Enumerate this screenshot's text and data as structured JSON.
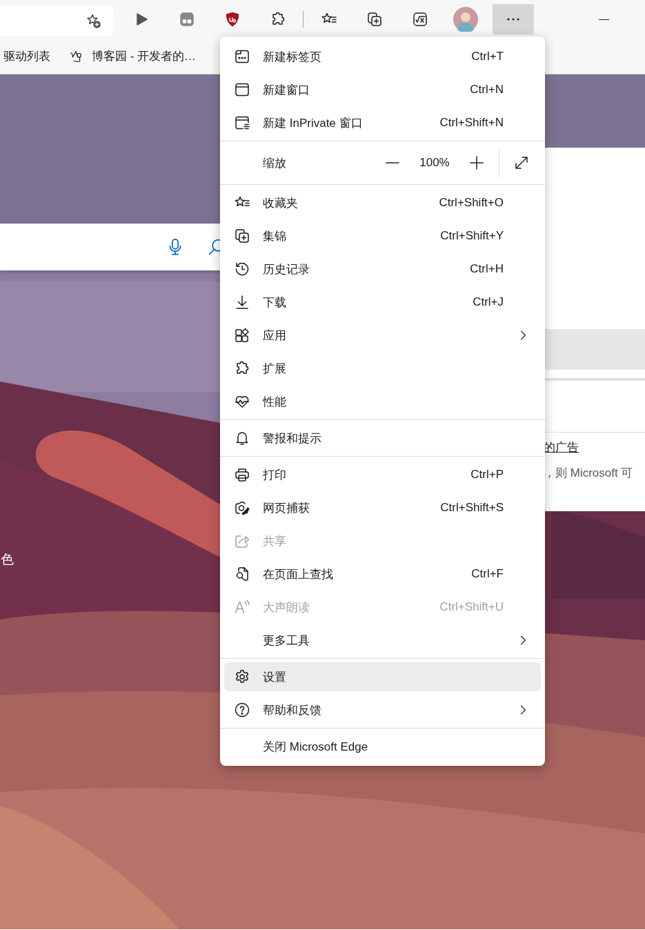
{
  "toolbar": {
    "buttons": [
      {
        "selected": false
      },
      {
        "selected": false
      },
      {
        "selected": false
      },
      {
        "selected": false
      },
      {
        "selected": false
      },
      {
        "selected": false
      },
      {
        "selected": false
      },
      {
        "selected": false
      },
      {
        "selected": true
      }
    ]
  },
  "bookmarks": [
    {
      "label": "驱动列表"
    },
    {
      "label": "博客园 - 开发者的…"
    }
  ],
  "background_caption": "色",
  "side_panel": {
    "link": "的广告",
    "text": "，则 Microsoft 可"
  },
  "menu": {
    "sections": [
      [
        {
          "kind": "command",
          "label": "新建标签页",
          "shortcut": "Ctrl+T",
          "disabled": false,
          "submenu": false,
          "selected": false
        },
        {
          "kind": "command",
          "label": "新建窗口",
          "shortcut": "Ctrl+N",
          "disabled": false,
          "submenu": false,
          "selected": false
        },
        {
          "kind": "command",
          "label": "新建 InPrivate 窗口",
          "shortcut": "Ctrl+Shift+N",
          "disabled": false,
          "submenu": false,
          "selected": false
        }
      ],
      [
        {
          "kind": "zoom",
          "label": "缩放",
          "value": "100%"
        }
      ],
      [
        {
          "kind": "command",
          "label": "收藏夹",
          "shortcut": "Ctrl+Shift+O",
          "disabled": false,
          "submenu": false,
          "selected": false
        },
        {
          "kind": "command",
          "label": "集锦",
          "shortcut": "Ctrl+Shift+Y",
          "disabled": false,
          "submenu": false,
          "selected": false
        },
        {
          "kind": "command",
          "label": "历史记录",
          "shortcut": "Ctrl+H",
          "disabled": false,
          "submenu": false,
          "selected": false
        },
        {
          "kind": "command",
          "label": "下载",
          "shortcut": "Ctrl+J",
          "disabled": false,
          "submenu": false,
          "selected": false
        },
        {
          "kind": "command",
          "label": "应用",
          "disabled": false,
          "submenu": true,
          "selected": false
        },
        {
          "kind": "command",
          "label": "扩展",
          "disabled": false,
          "submenu": false,
          "selected": false
        },
        {
          "kind": "command",
          "label": "性能",
          "disabled": false,
          "submenu": false,
          "selected": false
        }
      ],
      [
        {
          "kind": "command",
          "label": "警报和提示",
          "disabled": false,
          "submenu": false,
          "selected": false
        }
      ],
      [
        {
          "kind": "command",
          "label": "打印",
          "shortcut": "Ctrl+P",
          "disabled": false,
          "submenu": false,
          "selected": false
        },
        {
          "kind": "command",
          "label": "网页捕获",
          "shortcut": "Ctrl+Shift+S",
          "disabled": false,
          "submenu": false,
          "selected": false
        },
        {
          "kind": "command",
          "label": "共享",
          "disabled": true,
          "submenu": false,
          "selected": false
        },
        {
          "kind": "command",
          "label": "在页面上查找",
          "shortcut": "Ctrl+F",
          "disabled": false,
          "submenu": false,
          "selected": false
        },
        {
          "kind": "command",
          "label": "大声朗读",
          "shortcut": "Ctrl+Shift+U",
          "disabled": true,
          "submenu": false,
          "selected": false
        },
        {
          "kind": "command",
          "label": "更多工具",
          "disabled": false,
          "submenu": true,
          "selected": false
        }
      ],
      [
        {
          "kind": "command",
          "label": "设置",
          "disabled": false,
          "submenu": false,
          "selected": true
        },
        {
          "kind": "command",
          "label": "帮助和反馈",
          "disabled": false,
          "submenu": true,
          "selected": false
        }
      ],
      [
        {
          "kind": "command",
          "label": "关闭 Microsoft Edge",
          "disabled": false,
          "submenu": false,
          "selected": false
        }
      ]
    ]
  }
}
